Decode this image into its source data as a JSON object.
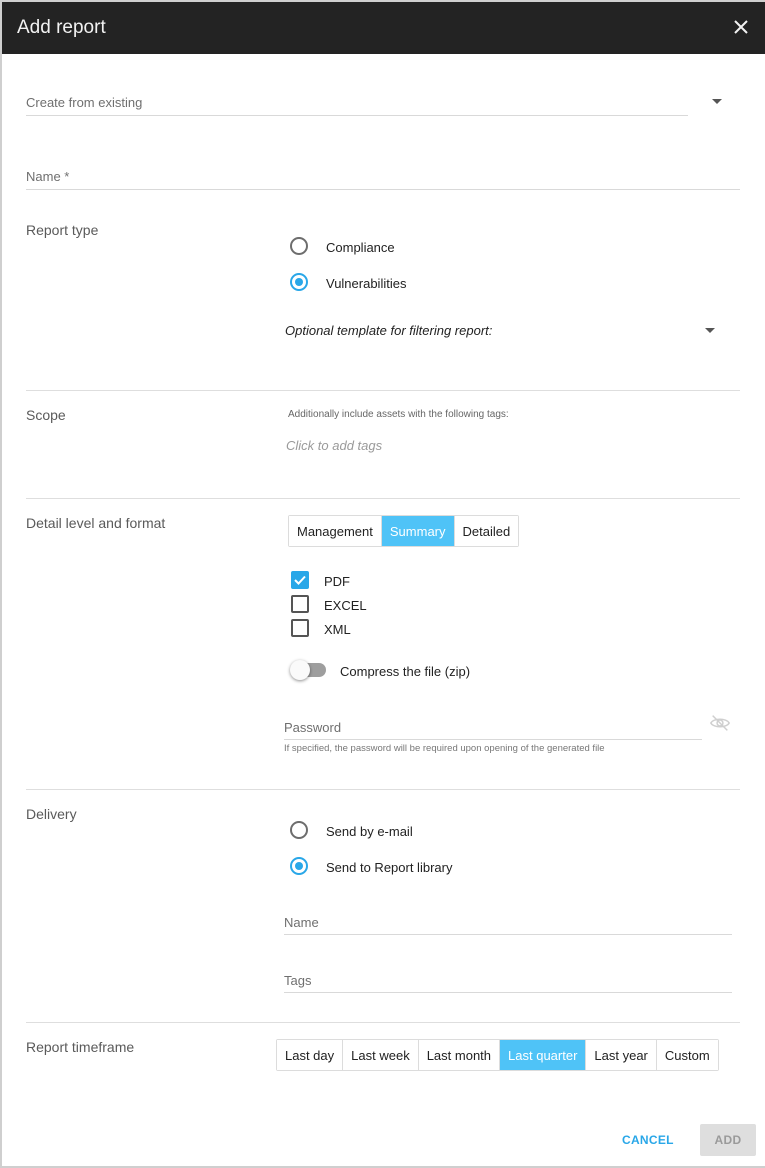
{
  "dialog": {
    "title": "Add report"
  },
  "create_from_existing": {
    "placeholder": "Create from existing"
  },
  "name_field": {
    "placeholder": "Name *"
  },
  "report_type": {
    "label": "Report type",
    "options": [
      {
        "label": "Compliance",
        "selected": false
      },
      {
        "label": "Vulnerabilities",
        "selected": true
      }
    ],
    "template_placeholder": "Optional template for filtering report:"
  },
  "scope": {
    "label": "Scope",
    "hint": "Additionally include assets with the following tags:",
    "tags_placeholder": "Click to add tags"
  },
  "detail": {
    "label": "Detail level and format",
    "levels": [
      {
        "label": "Management",
        "active": false
      },
      {
        "label": "Summary",
        "active": true
      },
      {
        "label": "Detailed",
        "active": false
      }
    ],
    "formats": [
      {
        "label": "PDF",
        "checked": true
      },
      {
        "label": "EXCEL",
        "checked": false
      },
      {
        "label": "XML",
        "checked": false
      }
    ],
    "compress_label": "Compress the file (zip)",
    "compress_on": false,
    "password_placeholder": "Password",
    "password_hint": "If specified, the password will be required upon opening of the generated file"
  },
  "delivery": {
    "label": "Delivery",
    "options": [
      {
        "label": "Send by e-mail",
        "selected": false
      },
      {
        "label": "Send to Report library",
        "selected": true
      }
    ],
    "name_placeholder": "Name",
    "tags_placeholder": "Tags"
  },
  "timeframe": {
    "label": "Report timeframe",
    "options": [
      {
        "label": "Last day",
        "active": false
      },
      {
        "label": "Last week",
        "active": false
      },
      {
        "label": "Last month",
        "active": false
      },
      {
        "label": "Last quarter",
        "active": true
      },
      {
        "label": "Last year",
        "active": false
      },
      {
        "label": "Custom",
        "active": false
      }
    ]
  },
  "footer": {
    "cancel_label": "CANCEL",
    "add_label": "ADD"
  },
  "colors": {
    "accent": "#29a7e8",
    "active_segment": "#4fc3f7",
    "titlebar": "#232323"
  }
}
